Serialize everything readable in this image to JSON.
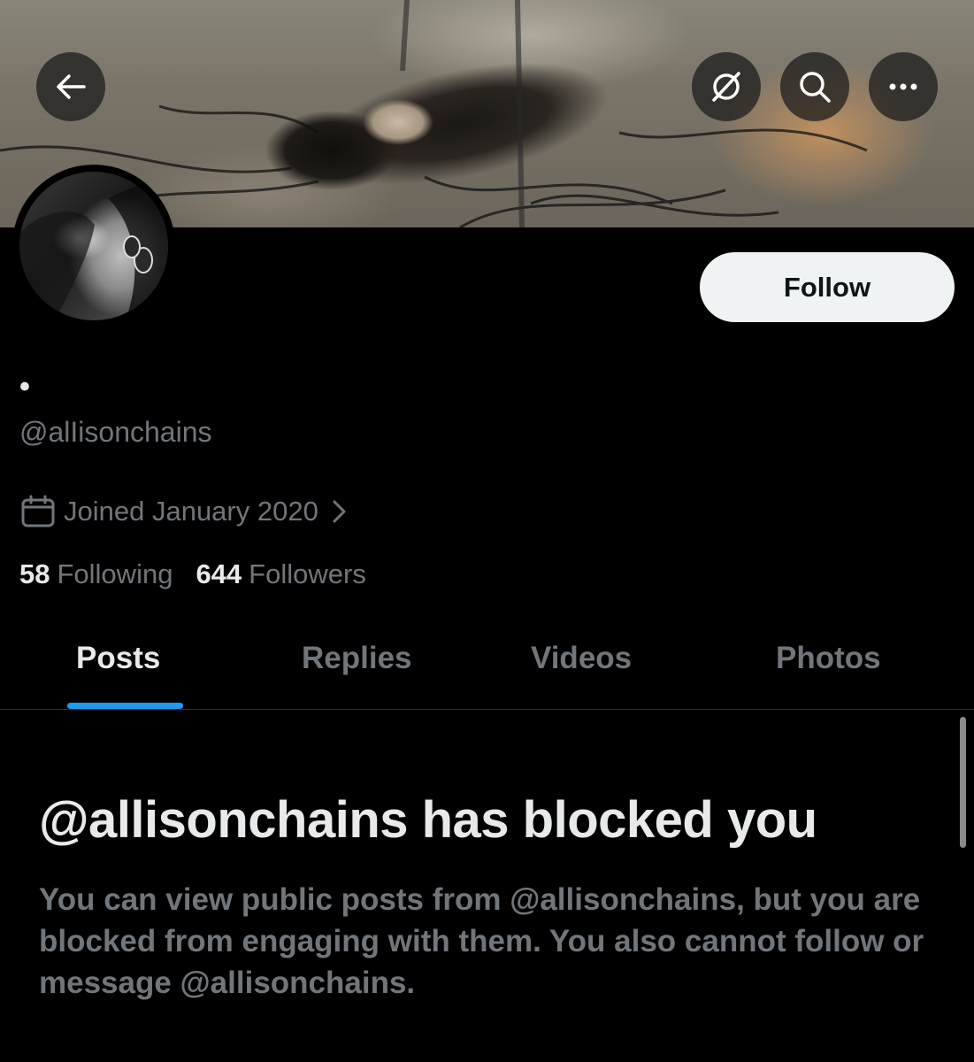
{
  "header": {
    "back_icon": "arrow-left-icon",
    "grok_icon": "grok-icon",
    "search_icon": "search-icon",
    "more_icon": "more-horizontal-icon"
  },
  "profile": {
    "display_name": "•",
    "handle": "@alIisonchains",
    "joined": "Joined January 2020",
    "follow_label": "Follow",
    "following_count": "58",
    "following_label": "Following",
    "followers_count": "644",
    "followers_label": "Followers"
  },
  "tabs": [
    {
      "label": "Posts",
      "active": true
    },
    {
      "label": "Replies",
      "active": false
    },
    {
      "label": "Videos",
      "active": false
    },
    {
      "label": "Photos",
      "active": false
    }
  ],
  "blocked": {
    "title": "@allisonchains has blocked you",
    "body": "You can view public posts from @allisonchains, but you are blocked from engaging with them. You also cannot follow or message @allisonchains."
  },
  "colors": {
    "background": "#000000",
    "primary_text": "#e7e9ea",
    "secondary_text": "#71767b",
    "accent": "#1d9bf0",
    "follow_button_bg": "#eff3f4"
  }
}
